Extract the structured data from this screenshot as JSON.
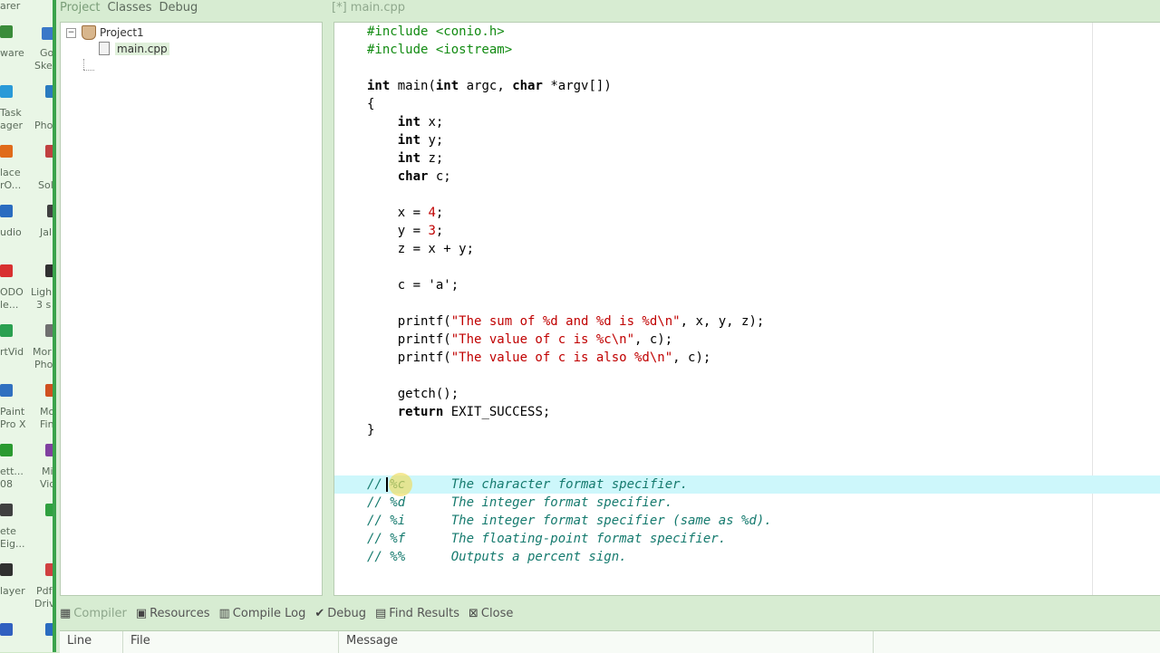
{
  "desktop": {
    "labels": [
      "arer",
      "ware",
      "Go",
      "Ske",
      "Task",
      "ager",
      "Pho",
      "lace",
      "rO...",
      "Sol",
      "udio",
      "Jal",
      "ODO",
      "le...",
      "Ligh",
      "3 s",
      "rtVid",
      "Mor",
      "Pho",
      "Paint",
      "Pro X",
      "Mo",
      "Fin",
      "ett...",
      "08",
      "Mi",
      "Vid",
      "ete",
      "Eig...",
      "layer",
      "Pdf",
      "Driv"
    ]
  },
  "sidebar": {
    "tabs": [
      "Project",
      "Classes",
      "Debug"
    ],
    "project_name": "Project1",
    "file_name": "main.cpp",
    "expander": "−"
  },
  "editor": {
    "tab_label": "[*] main.cpp",
    "lines": [
      [
        {
          "t": "#include <conio.h>",
          "c": "pp"
        }
      ],
      [
        {
          "t": "#include <iostream>",
          "c": "pp"
        }
      ],
      [
        {
          "t": ""
        }
      ],
      [
        {
          "t": "int",
          "c": "kw"
        },
        {
          "t": " main("
        },
        {
          "t": "int",
          "c": "kw"
        },
        {
          "t": " argc, "
        },
        {
          "t": "char",
          "c": "kw"
        },
        {
          "t": " *argv[])"
        }
      ],
      [
        {
          "t": "{"
        }
      ],
      [
        {
          "t": "    "
        },
        {
          "t": "int",
          "c": "kw"
        },
        {
          "t": " x;"
        }
      ],
      [
        {
          "t": "    "
        },
        {
          "t": "int",
          "c": "kw"
        },
        {
          "t": " y;"
        }
      ],
      [
        {
          "t": "    "
        },
        {
          "t": "int",
          "c": "kw"
        },
        {
          "t": " z;"
        }
      ],
      [
        {
          "t": "    "
        },
        {
          "t": "char",
          "c": "kw"
        },
        {
          "t": " c;"
        }
      ],
      [
        {
          "t": ""
        }
      ],
      [
        {
          "t": "    x = "
        },
        {
          "t": "4",
          "c": "num"
        },
        {
          "t": ";"
        }
      ],
      [
        {
          "t": "    y = "
        },
        {
          "t": "3",
          "c": "num"
        },
        {
          "t": ";"
        }
      ],
      [
        {
          "t": "    z = x + y;"
        }
      ],
      [
        {
          "t": ""
        }
      ],
      [
        {
          "t": "    c = 'a';"
        }
      ],
      [
        {
          "t": ""
        }
      ],
      [
        {
          "t": "    printf("
        },
        {
          "t": "\"The sum of %d and %d is %d\\n\"",
          "c": "str"
        },
        {
          "t": ", x, y, z);"
        }
      ],
      [
        {
          "t": "    printf("
        },
        {
          "t": "\"The value of c is %c\\n\"",
          "c": "str"
        },
        {
          "t": ", c);"
        }
      ],
      [
        {
          "t": "    printf("
        },
        {
          "t": "\"The value of c is also %d\\n\"",
          "c": "str"
        },
        {
          "t": ", c);"
        }
      ],
      [
        {
          "t": ""
        }
      ],
      [
        {
          "t": "    getch();"
        }
      ],
      [
        {
          "t": "    "
        },
        {
          "t": "return",
          "c": "kw"
        },
        {
          "t": " EXIT_SUCCESS;"
        }
      ],
      [
        {
          "t": "}"
        }
      ],
      [
        {
          "t": ""
        }
      ],
      [
        {
          "t": ""
        }
      ],
      [
        {
          "t": "// %c      The character format specifier.",
          "c": "cm"
        }
      ],
      [
        {
          "t": "// %d      The integer format specifier.",
          "c": "cm"
        }
      ],
      [
        {
          "t": "// %i      The integer format specifier (same as %d).",
          "c": "cm"
        }
      ],
      [
        {
          "t": "// %f      The floating-point format specifier.",
          "c": "cm"
        }
      ],
      [
        {
          "t": "// %%      Outputs a percent sign.",
          "c": "cm"
        }
      ]
    ],
    "highlighted_line": 25
  },
  "bottom_panel": {
    "tabs": [
      {
        "label": "Compiler",
        "icon": "compiler-icon",
        "glyph": "▦"
      },
      {
        "label": "Resources",
        "icon": "resources-icon",
        "glyph": "▣"
      },
      {
        "label": "Compile Log",
        "icon": "compile-log-icon",
        "glyph": "▥"
      },
      {
        "label": "Debug",
        "icon": "debug-icon",
        "glyph": "✔"
      },
      {
        "label": "Find Results",
        "icon": "find-results-icon",
        "glyph": "▤"
      },
      {
        "label": "Close",
        "icon": "close-icon",
        "glyph": "⊠"
      }
    ],
    "columns": [
      "Line",
      "File",
      "Message"
    ]
  },
  "colors": {
    "app_bg": "#d7ecd2",
    "highlight_line": "#cdf7fb",
    "string": "#c00000",
    "preprocessor": "#128b12",
    "comment": "#157a6e"
  }
}
